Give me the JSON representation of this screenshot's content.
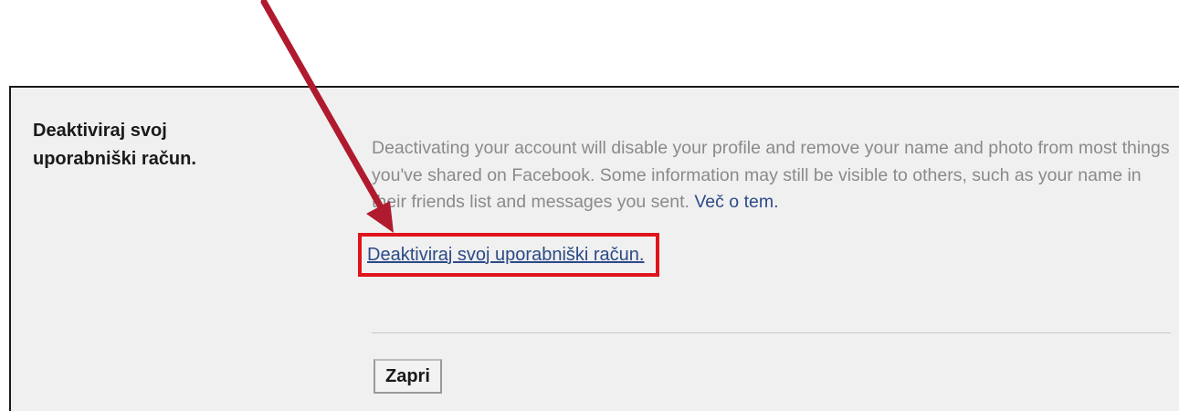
{
  "settings": {
    "section_title": "Deaktiviraj svoj uporabniški račun.",
    "description": "Deactivating your account will disable your profile and remove your name and photo from most things you've shared on Facebook. Some information may still be visible to others, such as your name in their friends list and messages you sent.",
    "learn_more_label": "Več o tem.",
    "deactivate_link_label": "Deaktiviraj svoj uporabniški račun.",
    "close_button_label": "Zapri"
  },
  "colors": {
    "panel_background": "#f0f0f0",
    "link": "#2d4a87",
    "highlight_box": "#e0141c",
    "annotation_arrow": "#b01a2e",
    "description_text": "#8a8a8a"
  },
  "icons": {
    "annotation": "arrow-pointer-icon"
  }
}
